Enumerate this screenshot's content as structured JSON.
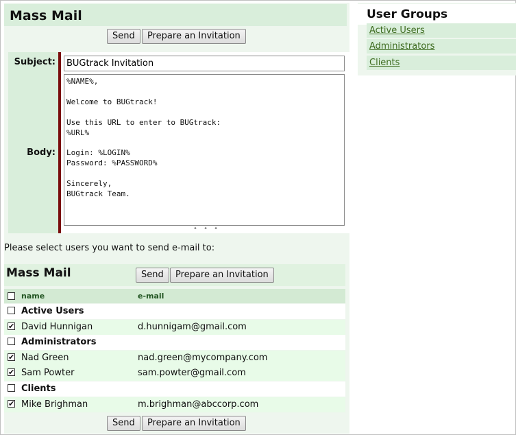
{
  "mass_mail": {
    "title": "Mass Mail",
    "send_label": "Send",
    "prepare_label": "Prepare an Invitation",
    "subject_label": "Subject:",
    "subject_value": "BUGtrack Invitation",
    "body_label": "Body:",
    "body_text": "%NAME%,\n\nWelcome to BUGtrack!\n\nUse this URL to enter to BUGtrack:\n%URL%\n\nLogin: %LOGIN%\nPassword: %PASSWORD%\n\nSincerely,\nBUGtrack Team.",
    "resize_grip": "• • •",
    "prompt": "Please select users you want to send e-mail to:"
  },
  "recipients": {
    "title": "Mass Mail",
    "send_label": "Send",
    "prepare_label": "Prepare an Invitation",
    "columns": {
      "name": "name",
      "email": "e-mail"
    },
    "rows": [
      {
        "name": "Active Users",
        "email": "",
        "checked": false,
        "type": "group"
      },
      {
        "name": "David Hunnigan",
        "email": "d.hunnigam@gmail.com",
        "checked": true,
        "type": "user"
      },
      {
        "name": "Administrators",
        "email": "",
        "checked": false,
        "type": "group"
      },
      {
        "name": "Nad Green",
        "email": "nad.green@mycompany.com",
        "checked": true,
        "type": "user"
      },
      {
        "name": "Sam Powter",
        "email": "sam.powter@gmail.com",
        "checked": true,
        "type": "user"
      },
      {
        "name": "Clients",
        "email": "",
        "checked": false,
        "type": "group"
      },
      {
        "name": "Mike Brighman",
        "email": "m.brighman@abccorp.com",
        "checked": true,
        "type": "user"
      }
    ],
    "footer_send_label": "Send",
    "footer_prepare_label": "Prepare an Invitation"
  },
  "user_groups": {
    "title": "User Groups",
    "items": [
      "Active Users",
      "Administrators",
      "Clients"
    ]
  },
  "check_mark": "✔",
  "colors": {
    "panel_bg": "#eef6ee",
    "header_bg": "#d9eedb",
    "accent_bar": "#7a0d0d",
    "link": "#3d6b1f"
  }
}
